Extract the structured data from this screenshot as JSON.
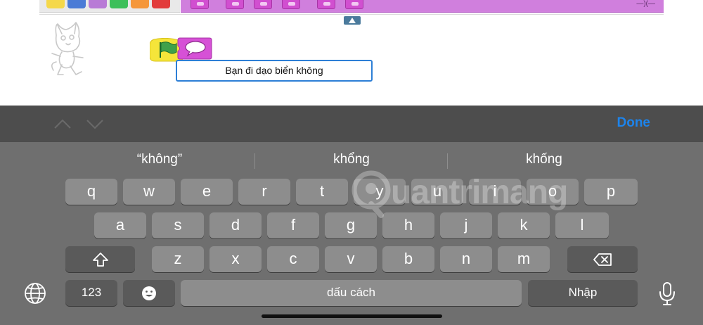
{
  "app": {
    "category_colors": [
      "#f5d84a",
      "#4a7bd6",
      "#b87ad6",
      "#3cbf5a",
      "#f5973a",
      "#e23b3b"
    ],
    "palette_color": "#d07fdd",
    "input_value": "Bạn đi dạo biển không"
  },
  "keyboard": {
    "done_label": "Done",
    "suggestions": [
      "“không”",
      "khổng",
      "khống"
    ],
    "rows": [
      [
        "q",
        "w",
        "e",
        "r",
        "t",
        "y",
        "u",
        "i",
        "o",
        "p"
      ],
      [
        "a",
        "s",
        "d",
        "f",
        "g",
        "h",
        "j",
        "k",
        "l"
      ],
      [
        "z",
        "x",
        "c",
        "v",
        "b",
        "n",
        "m"
      ]
    ],
    "numbers_label": "123",
    "space_label": "dấu cách",
    "return_label": "Nhập",
    "accent_color": "#1d84ec"
  },
  "watermark": {
    "text": "uantrimang"
  }
}
